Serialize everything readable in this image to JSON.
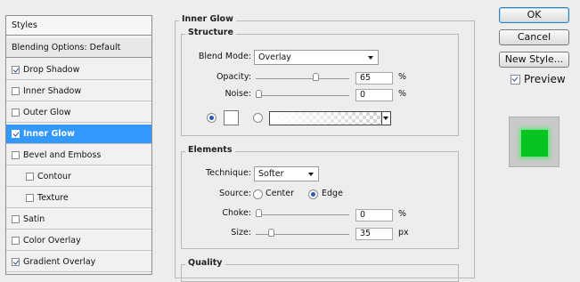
{
  "styles_list": {
    "header": "Styles",
    "blending_options": "Blending Options: Default",
    "items": [
      {
        "label": "Drop Shadow",
        "checked": true
      },
      {
        "label": "Inner Shadow",
        "checked": false
      },
      {
        "label": "Outer Glow",
        "checked": false
      },
      {
        "label": "Inner Glow",
        "checked": true,
        "selected": true
      },
      {
        "label": "Bevel and Emboss",
        "checked": false
      },
      {
        "label": "Contour",
        "checked": false
      },
      {
        "label": "Texture",
        "checked": false
      },
      {
        "label": "Satin",
        "checked": false
      },
      {
        "label": "Color Overlay",
        "checked": false
      },
      {
        "label": "Gradient Overlay",
        "checked": true
      }
    ]
  },
  "inner_glow": {
    "title": "Inner Glow",
    "structure": {
      "title": "Structure",
      "blend_mode_label": "Blend Mode:",
      "blend_mode_value": "Overlay",
      "opacity_label": "Opacity:",
      "opacity_value": "65",
      "opacity_unit": "%",
      "opacity_fraction": 0.65,
      "noise_label": "Noise:",
      "noise_value": "0",
      "noise_unit": "%",
      "noise_fraction": 0.0,
      "fill_mode": "color"
    },
    "elements": {
      "title": "Elements",
      "technique_label": "Technique:",
      "technique_value": "Softer",
      "source_label": "Source:",
      "source_center_label": "Center",
      "source_edge_label": "Edge",
      "source_selected": "Edge",
      "choke_label": "Choke:",
      "choke_value": "0",
      "choke_unit": "%",
      "choke_fraction": 0.0,
      "size_label": "Size:",
      "size_value": "35",
      "size_unit": "px",
      "size_fraction": 0.14
    },
    "quality": {
      "title": "Quality"
    }
  },
  "buttons": {
    "ok": "OK",
    "cancel": "Cancel",
    "new_style": "New Style...",
    "preview_label": "Preview",
    "preview_checked": true
  },
  "colors": {
    "selection": "#3399ff",
    "preview_fill": "#08c321"
  }
}
